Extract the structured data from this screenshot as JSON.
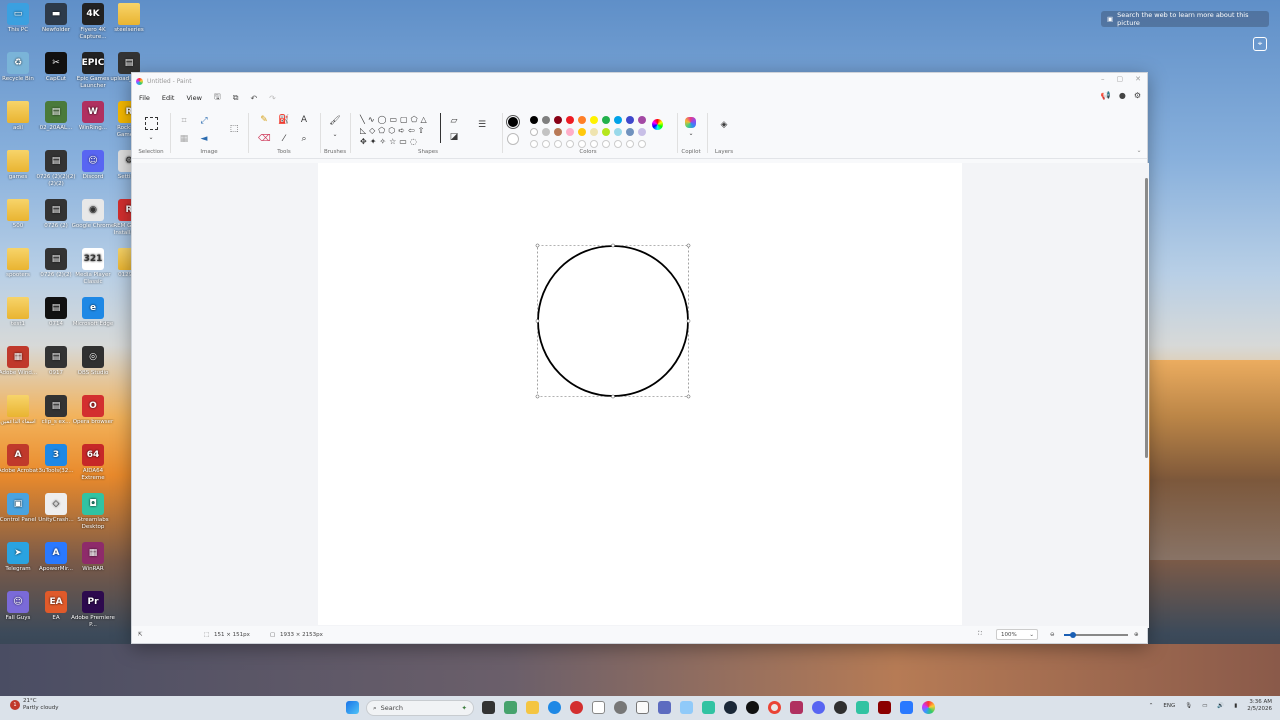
{
  "desktop": {
    "icons": [
      {
        "label": "This PC",
        "color": "#3ba0e0",
        "glyph": "▭"
      },
      {
        "label": "Recycle Bin",
        "color": "#7ab4d8",
        "glyph": "♻"
      },
      {
        "label": "adil",
        "color": "#f4c542",
        "glyph": ""
      },
      {
        "label": "games",
        "color": "#f4c542",
        "glyph": ""
      },
      {
        "label": "500",
        "color": "#f4c542",
        "glyph": ""
      },
      {
        "label": "spooters",
        "color": "#f4c542",
        "glyph": ""
      },
      {
        "label": "test1",
        "color": "#f4c542",
        "glyph": ""
      },
      {
        "label": "Adobe Wind...",
        "color": "#c0392b",
        "glyph": "▦"
      },
      {
        "label": "أسماء الداعمين",
        "color": "#f4c542",
        "glyph": ""
      },
      {
        "label": "Adobe Acrobat",
        "color": "#c0392b",
        "glyph": "A"
      },
      {
        "label": "Control Panel",
        "color": "#4aa3df",
        "glyph": "▣"
      },
      {
        "label": "Telegram",
        "color": "#2aa3e0",
        "glyph": "➤"
      },
      {
        "label": "Fall Guys",
        "color": "#7a6ad8",
        "glyph": "☺"
      },
      {
        "label": "Newfolder",
        "color": "#2d3a4a",
        "glyph": "▬"
      },
      {
        "label": "CapCut",
        "color": "#111111",
        "glyph": "✂"
      },
      {
        "label": "02_20AAL...",
        "color": "#4a7a3a",
        "glyph": "▤"
      },
      {
        "label": "0726 (2)(2)(2)(2)(2)",
        "color": "#333333",
        "glyph": "▤"
      },
      {
        "label": "0726 (2)",
        "color": "#333333",
        "glyph": "▤"
      },
      {
        "label": "0726 (2)(2)",
        "color": "#333333",
        "glyph": "▤"
      },
      {
        "label": "0714",
        "color": "#111111",
        "glyph": "▤"
      },
      {
        "label": "0917",
        "color": "#333333",
        "glyph": "▤"
      },
      {
        "label": "clip_s ex...",
        "color": "#333333",
        "glyph": "▤"
      },
      {
        "label": "3uTools(32...",
        "color": "#1e88e5",
        "glyph": "3"
      },
      {
        "label": "UnityCrash...",
        "color": "#eeeeee",
        "glyph": "◇"
      },
      {
        "label": "ApowerMir...",
        "color": "#2979ff",
        "glyph": "A"
      },
      {
        "label": "EA",
        "color": "#e05a2a",
        "glyph": "EA"
      },
      {
        "label": "Fiyero 4K Capture...",
        "color": "#222222",
        "glyph": "4K"
      },
      {
        "label": "Epic Games Launcher",
        "color": "#222222",
        "glyph": "EPIC"
      },
      {
        "label": "WinRing...",
        "color": "#b03060",
        "glyph": "W"
      },
      {
        "label": "Discord",
        "color": "#5865f2",
        "glyph": "☺"
      },
      {
        "label": "Google Chrome",
        "color": "#e8e8e8",
        "glyph": "◉"
      },
      {
        "label": "Media Player Classic",
        "color": "#ffffff",
        "glyph": "321"
      },
      {
        "label": "Microsoft Edge",
        "color": "#1e88e5",
        "glyph": "e"
      },
      {
        "label": "OBS Studio",
        "color": "#303030",
        "glyph": "◎"
      },
      {
        "label": "Opera browser",
        "color": "#d32f2f",
        "glyph": "O"
      },
      {
        "label": "AIDA64 Extreme",
        "color": "#c62828",
        "glyph": "64"
      },
      {
        "label": "Streamlabs Desktop",
        "color": "#31c3a2",
        "glyph": "◘"
      },
      {
        "label": "WinRAR",
        "color": "#8e2b6a",
        "glyph": "▦"
      },
      {
        "label": "Adobe Premiere P...",
        "color": "#2d0a4e",
        "glyph": "Pr"
      },
      {
        "label": "steelseries",
        "color": "#f2f2f2",
        "glyph": ""
      },
      {
        "label": "upload_172...",
        "color": "#333333",
        "glyph": "▤"
      },
      {
        "label": "Rockstar Games...",
        "color": "#f5b800",
        "glyph": "R"
      },
      {
        "label": "Settings",
        "color": "#e0e0e0",
        "glyph": "⚙"
      },
      {
        "label": "REM Global Installation",
        "color": "#d32f2f",
        "glyph": "R"
      },
      {
        "label": "0129(1)",
        "color": "#f4c542",
        "glyph": ""
      }
    ],
    "image_search_hint": "Search the web to learn more about this picture"
  },
  "window": {
    "title": "Untitled - Paint",
    "menu": [
      "File",
      "Edit",
      "View"
    ],
    "ribbon_groups": [
      "Selection",
      "Image",
      "Tools",
      "Brushes",
      "Shapes",
      "Colors",
      "Copilot",
      "Layers"
    ],
    "colors": {
      "primary": "#000000",
      "row1": [
        "#000000",
        "#7f7f7f",
        "#880015",
        "#ed1c24",
        "#ff7f27",
        "#fff200",
        "#22b14c",
        "#00a2e8",
        "#3f48cc",
        "#a349a4"
      ],
      "row2": [
        "#ffffff",
        "#c3c3c3",
        "#b97a57",
        "#ffaec9",
        "#ffc90e",
        "#efe4b0",
        "#b5e61d",
        "#99d9ea",
        "#7092be",
        "#c8bfe7"
      ]
    },
    "status": {
      "selection_size": "151 × 151px",
      "canvas_size": "1933 × 2153px",
      "zoom": "100%"
    }
  },
  "taskbar": {
    "weather_temp": "21°C",
    "weather_desc": "Partly cloudy",
    "search_placeholder": "Search",
    "language": "ENG",
    "time": "3:36 AM",
    "date": "2/5/2026",
    "notification_badge": "1"
  }
}
